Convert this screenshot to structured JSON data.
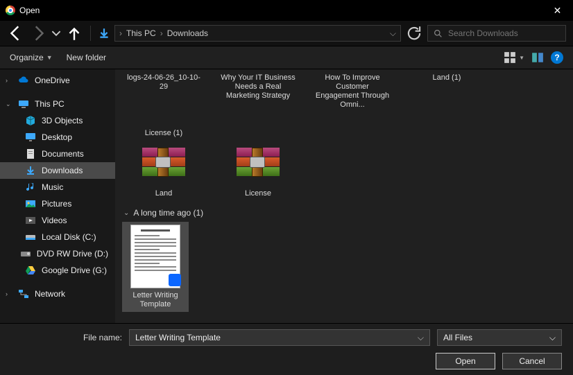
{
  "window": {
    "title": "Open",
    "close_tooltip": "Close"
  },
  "nav": {
    "back": "←",
    "fwd": "→",
    "up": "↑"
  },
  "breadcrumb": {
    "root": "This PC",
    "current": "Downloads"
  },
  "search": {
    "placeholder": "Search Downloads"
  },
  "toolbar": {
    "organize": "Organize",
    "new_folder": "New folder",
    "help": "?"
  },
  "sidebar": {
    "onedrive": "OneDrive",
    "this_pc": "This PC",
    "items": [
      {
        "icon": "cube",
        "label": "3D Objects"
      },
      {
        "icon": "desktop",
        "label": "Desktop"
      },
      {
        "icon": "doc",
        "label": "Documents"
      },
      {
        "icon": "download",
        "label": "Downloads",
        "selected": true
      },
      {
        "icon": "music",
        "label": "Music"
      },
      {
        "icon": "picture",
        "label": "Pictures"
      },
      {
        "icon": "video",
        "label": "Videos"
      },
      {
        "icon": "disk",
        "label": "Local Disk (C:)"
      },
      {
        "icon": "dvd",
        "label": "DVD RW Drive (D:)"
      },
      {
        "icon": "gdrive",
        "label": "Google Drive (G:)"
      }
    ],
    "network": "Network"
  },
  "content": {
    "top_row": [
      {
        "label": "logs-24-06-26_10-10-29"
      },
      {
        "label": "Why Your IT Business Needs a Real Marketing Strategy"
      },
      {
        "label": "How To Improve Customer Engagement Through Omni..."
      },
      {
        "label": "Land (1)"
      },
      {
        "label": "License (1)"
      }
    ],
    "rar_row": [
      {
        "label": "Land"
      },
      {
        "label": "License"
      }
    ],
    "group": "A long time ago (1)",
    "doc_item": {
      "label": "Letter Writing Template",
      "selected": true
    }
  },
  "footer": {
    "filename_label": "File name:",
    "filename_value": "Letter Writing Template",
    "type_filter": "All Files",
    "open": "Open",
    "cancel": "Cancel"
  }
}
